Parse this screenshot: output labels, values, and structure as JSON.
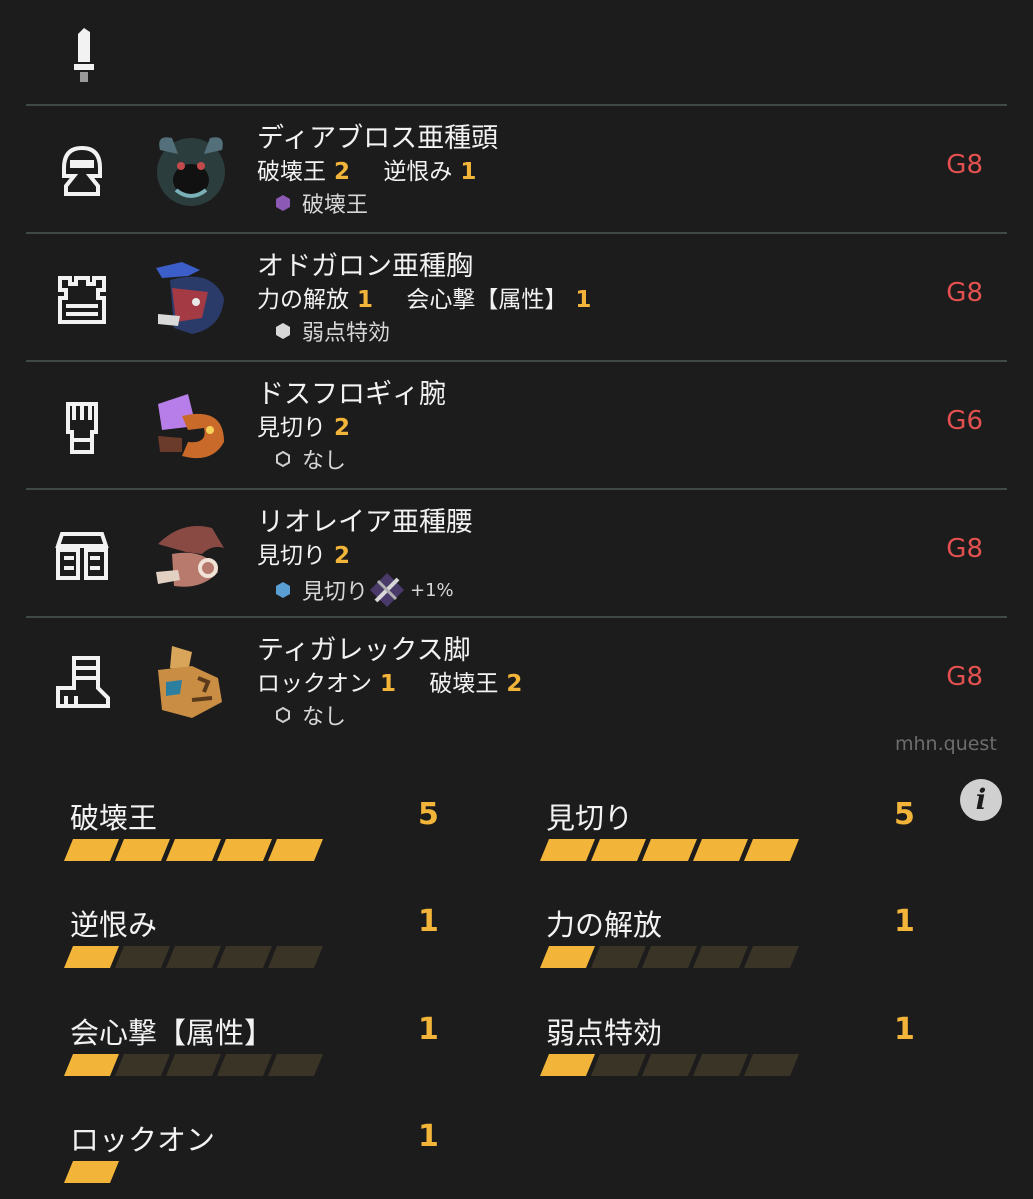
{
  "weapon": {
    "icon": "great-sword-icon"
  },
  "armor": [
    {
      "slot": "head",
      "slot_icon": "helmet-icon",
      "monster_icon": "diablos-subspecies-icon",
      "name": "ディアブロス亜種頭",
      "skills": [
        {
          "name": "破壊王",
          "level": "2"
        },
        {
          "name": "逆恨み",
          "level": "1"
        }
      ],
      "deco": {
        "gem_color": "#8c5ab4",
        "gem_shape": "filled",
        "text": "破壊王",
        "bonus": ""
      },
      "rank": "G8"
    },
    {
      "slot": "chest",
      "slot_icon": "chest-armor-icon",
      "monster_icon": "odogaron-subspecies-icon",
      "name": "オドガロン亜種胸",
      "skills": [
        {
          "name": "力の解放",
          "level": "1"
        },
        {
          "name": "会心撃【属性】",
          "level": "1"
        }
      ],
      "deco": {
        "gem_color": "#d8d8d8",
        "gem_shape": "filled",
        "text": "弱点特効",
        "bonus": ""
      },
      "rank": "G8"
    },
    {
      "slot": "arms",
      "slot_icon": "gauntlet-icon",
      "monster_icon": "dodogama-icon",
      "name": "ドスフロギィ腕",
      "skills": [
        {
          "name": "見切り",
          "level": "2"
        }
      ],
      "deco": {
        "gem_color": "#cfcfcf",
        "gem_shape": "outline",
        "text": "なし",
        "bonus": ""
      },
      "rank": "G6"
    },
    {
      "slot": "waist",
      "slot_icon": "waist-armor-icon",
      "monster_icon": "rathian-subspecies-icon",
      "name": "リオレイア亜種腰",
      "skills": [
        {
          "name": "見切り",
          "level": "2"
        }
      ],
      "deco": {
        "gem_color": "#5a9fd4",
        "gem_shape": "filled",
        "text": "見切り",
        "bonus": "+1%"
      },
      "rank": "G8"
    },
    {
      "slot": "legs",
      "slot_icon": "boots-icon",
      "monster_icon": "tigrex-icon",
      "name": "ティガレックス脚",
      "skills": [
        {
          "name": "ロックオン",
          "level": "1"
        },
        {
          "name": "破壊王",
          "level": "2"
        }
      ],
      "deco": {
        "gem_color": "#cfcfcf",
        "gem_shape": "outline",
        "text": "なし",
        "bonus": ""
      },
      "rank": "G8"
    }
  ],
  "watermark": "mhn.quest",
  "info_button": {
    "label": "i",
    "icon": "info-icon"
  },
  "skill_summary": [
    {
      "name": "破壊王",
      "level": "5",
      "max": 5
    },
    {
      "name": "見切り",
      "level": "5",
      "max": 5
    },
    {
      "name": "逆恨み",
      "level": "1",
      "max": 5
    },
    {
      "name": "力の解放",
      "level": "1",
      "max": 5
    },
    {
      "name": "会心撃【属性】",
      "level": "1",
      "max": 5
    },
    {
      "name": "弱点特効",
      "level": "1",
      "max": 5
    },
    {
      "name": "ロックオン",
      "level": "1",
      "max": 1
    }
  ],
  "colors": {
    "accent": "#f2b53a",
    "rank": "#e25050",
    "bar_empty": "#3a3426",
    "divider": "#3f4a48"
  }
}
